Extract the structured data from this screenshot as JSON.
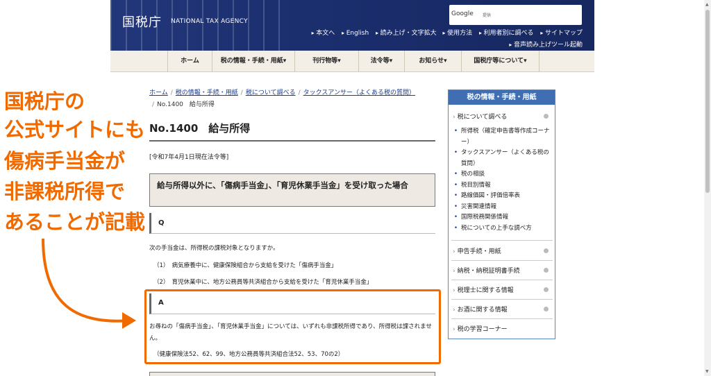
{
  "header": {
    "logo_jp": "国税庁",
    "logo_en": "NATIONAL TAX AGENCY",
    "search_brand": "Google",
    "search_placeholder": "提供",
    "links": [
      "本文へ",
      "English",
      "読み上げ・文字拡大",
      "使用方法",
      "利用者別に調べる",
      "サイトマップ"
    ],
    "voice_link": "音声読み上げツール起動"
  },
  "nav": [
    "ホーム",
    "税の情報・手続・用紙▾",
    "刊行物等▾",
    "法令等▾",
    "お知らせ▾",
    "国税庁等について▾"
  ],
  "breadcrumb": {
    "items": [
      "ホーム",
      "税の情報・手続・用紙",
      "税について調べる",
      "タックスアンサー（よくある税の質問）"
    ],
    "current": "No.1400　給与所得"
  },
  "page": {
    "title": "No.1400　給与所得",
    "as_of": "[令和7年4月1日現在法令等]",
    "question_title": "給与所得以外に、「傷病手当金」、「育児休業手当金」を受け取った場合",
    "q_label": "Q",
    "q_text": "次の手当金は、所得税の課税対象となりますか。",
    "q_item1": "（1）　病気療養中に、健康保険組合から支給を受けた「傷病手当金」",
    "q_item2": "（2）　育児休業中に、地方公務員等共済組合から支給を受けた「育児休業手当金」",
    "a_label": "A",
    "a_text": "お尋ねの「傷病手当金」、「育児休業手当金」については、いずれも非課税所得であり、所得税は課されません。",
    "a_ref": "（健康保険法52、62、99、地方公務員等共済組合法52、53、70の2）"
  },
  "sidebar": {
    "header": "税の情報・手続・用紙",
    "top": "税について調べる",
    "items": [
      "所得税（確定申告書等作成コーナー）",
      "タックスアンサー（よくある税の質問）",
      "税の相談",
      "税目別情報",
      "路線価図・評価倍率表",
      "災害関連情報",
      "国際税務関係情報",
      "税についての上手な調べ方"
    ],
    "sections": [
      "申告手続・用紙",
      "納税・納税証明書手続",
      "税理士に関する情報",
      "お酒に関する情報",
      "税の学習コーナー"
    ]
  },
  "annotation": {
    "lines": [
      "国税庁の",
      "公式サイトにも",
      "傷病手当金が",
      "非課税所得で",
      "あることが記載"
    ],
    "color": "#f06a00"
  }
}
